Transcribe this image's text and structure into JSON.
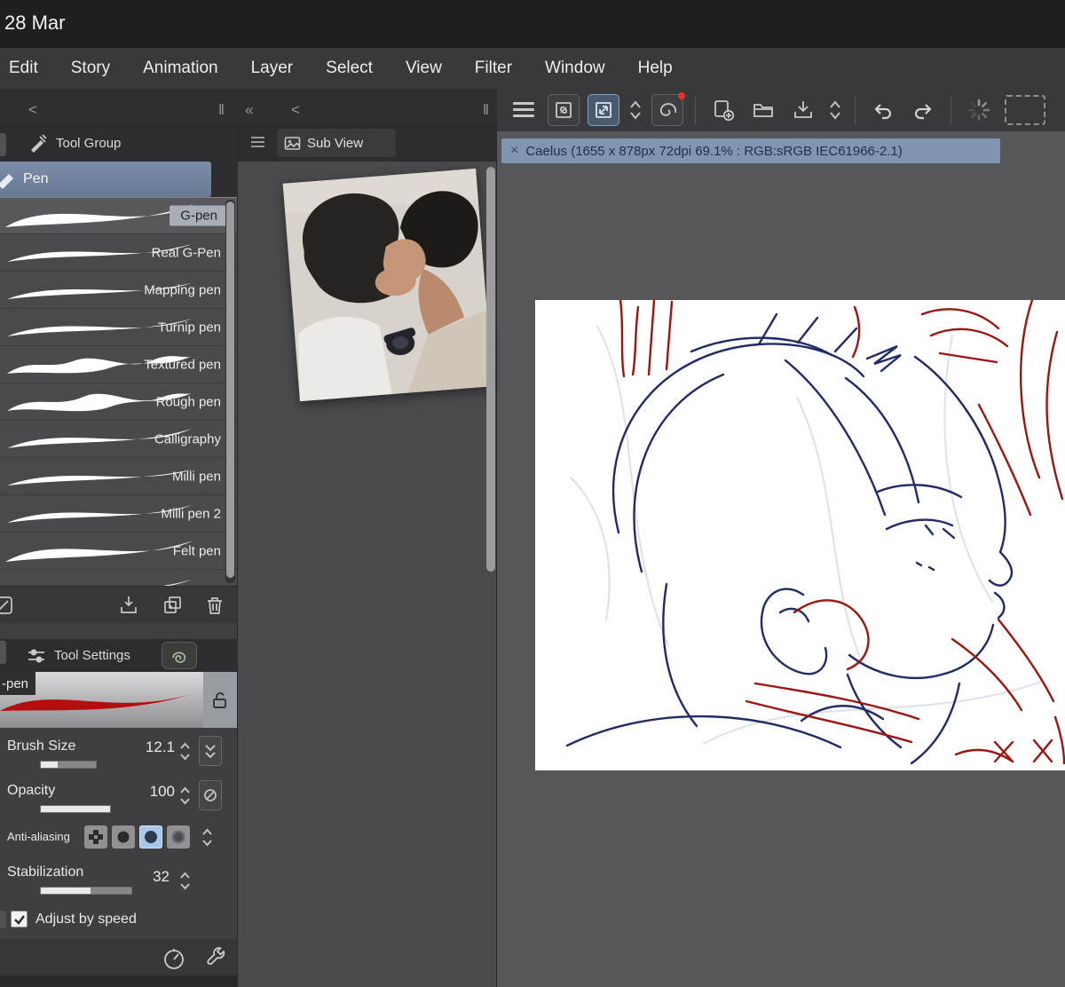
{
  "titlebar": {
    "date": "28 Mar"
  },
  "menubar": {
    "items": [
      "Edit",
      "Story",
      "Animation",
      "Layer",
      "Select",
      "View",
      "Filter",
      "Window",
      "Help"
    ]
  },
  "panel_controls": {
    "collapse": "<",
    "handle": "‖",
    "collapse_all": "«"
  },
  "document_tab": {
    "close_label": "×",
    "title": "Caelus (1655 x 878px 72dpi 69.1% : RGB:sRGB IEC61966-2.1)"
  },
  "tool_group_panel": {
    "title": "Tool Group",
    "selected_tool": "Pen",
    "selected_pen": "G-pen",
    "pens": [
      "G-pen",
      "Real G-Pen",
      "Mapping pen",
      "Turnip pen",
      "Textured pen",
      "Rough pen",
      "Calligraphy",
      "Milli pen",
      "Milli pen 2",
      "Felt pen"
    ]
  },
  "subview_panel": {
    "title": "Sub View"
  },
  "tool_settings_panel": {
    "title": "Tool Settings",
    "brush_name": "-pen",
    "brush_size": {
      "label": "Brush Size",
      "value": "12.1"
    },
    "opacity": {
      "label": "Opacity",
      "value": "100"
    },
    "anti_aliasing": {
      "label": "Anti-aliasing",
      "selected_index": 2
    },
    "stabilization": {
      "label": "Stabilization",
      "value": "32"
    },
    "adjust_by_speed": {
      "label": "Adjust by speed",
      "checked": true
    }
  },
  "colors": {
    "doc_tab_blue": "#8095af",
    "tool_select_blue": "#7c8da7",
    "aa_selected_blue": "#a9c7ea",
    "ink_navy": "#222b66",
    "ink_red": "#9e1410"
  },
  "icons": [
    "menu-icon",
    "fit-view-icon",
    "pan-zoom-icon",
    "stepper-up-down-icon",
    "special-ruler-icon",
    "new-canvas-icon",
    "open-folder-icon",
    "save-icon",
    "undo-icon",
    "redo-icon",
    "busy-spinner-icon",
    "marquee-icon",
    "sub-view-icon",
    "tool-group-icon",
    "pen-tool-icon",
    "download-brush-icon",
    "duplicate-brush-icon",
    "delete-brush-icon",
    "tool-settings-icon",
    "lasso-swirl-icon",
    "lock-open-icon",
    "circle-slash-icon",
    "gauge-icon",
    "wrench-icon",
    "checkbox-check-icon",
    "close-icon"
  ]
}
